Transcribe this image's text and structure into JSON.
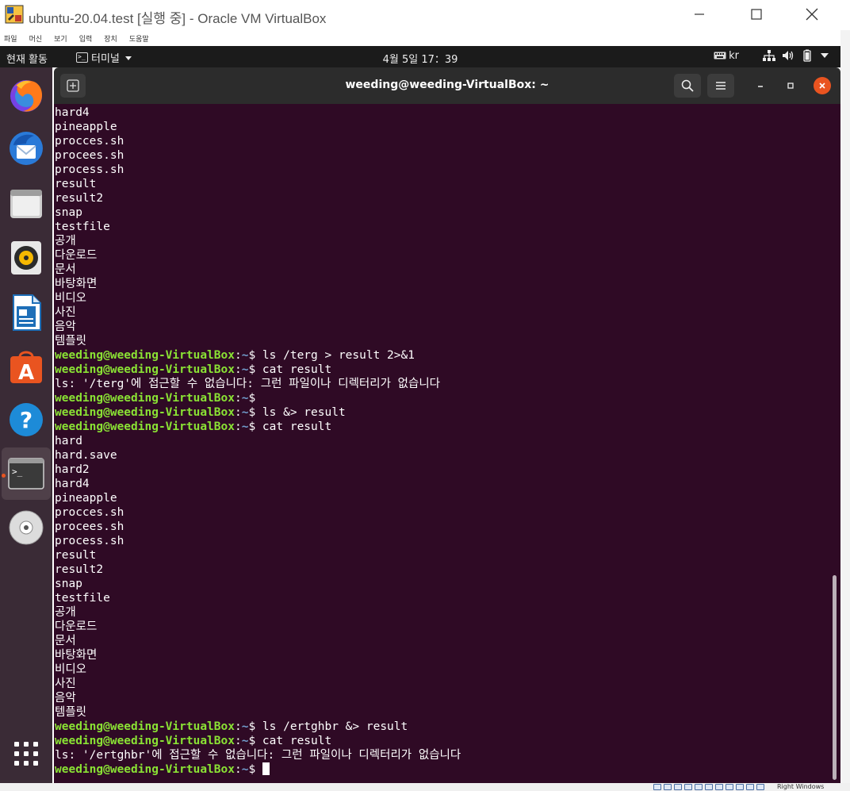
{
  "host_window": {
    "title": "ubuntu-20.04.test [실행 중] - Oracle VM VirtualBox",
    "menu": [
      "파일",
      "머신",
      "보기",
      "입력",
      "장치",
      "도움말"
    ],
    "host_key_label": "Right Windows"
  },
  "top_bar": {
    "activities": "현재 활동",
    "app_menu": "터미널",
    "clock": "4월 5일  17：39",
    "input_method": "kr"
  },
  "dock": {
    "items": [
      "firefox",
      "thunderbird",
      "files",
      "rhythmbox",
      "libreoffice-writer",
      "ubuntu-software",
      "help",
      "terminal",
      "dvd"
    ]
  },
  "terminal": {
    "title": "weeding@weeding-VirtualBox: ~",
    "prompt_user": "weeding@weeding-VirtualBox",
    "prompt_path": "~",
    "lines": [
      {
        "type": "out",
        "text": "hard4"
      },
      {
        "type": "out",
        "text": "pineapple"
      },
      {
        "type": "out",
        "text": "procces.sh"
      },
      {
        "type": "out",
        "text": "procees.sh"
      },
      {
        "type": "out",
        "text": "process.sh"
      },
      {
        "type": "out",
        "text": "result"
      },
      {
        "type": "out",
        "text": "result2"
      },
      {
        "type": "out",
        "text": "snap"
      },
      {
        "type": "out",
        "text": "testfile"
      },
      {
        "type": "out",
        "text": "공개"
      },
      {
        "type": "out",
        "text": "다운로드"
      },
      {
        "type": "out",
        "text": "문서"
      },
      {
        "type": "out",
        "text": "바탕화면"
      },
      {
        "type": "out",
        "text": "비디오"
      },
      {
        "type": "out",
        "text": "사진"
      },
      {
        "type": "out",
        "text": "음악"
      },
      {
        "type": "out",
        "text": "템플릿"
      },
      {
        "type": "cmd",
        "text": "ls /terg > result 2>&1"
      },
      {
        "type": "cmd",
        "text": "cat result"
      },
      {
        "type": "out",
        "text": "ls: '/terg'에 접근할 수 없습니다: 그런 파일이나 디렉터리가 없습니다"
      },
      {
        "type": "cmd",
        "text": ""
      },
      {
        "type": "cmd",
        "text": "ls &> result"
      },
      {
        "type": "cmd",
        "text": "cat result"
      },
      {
        "type": "out",
        "text": "hard"
      },
      {
        "type": "out",
        "text": "hard.save"
      },
      {
        "type": "out",
        "text": "hard2"
      },
      {
        "type": "out",
        "text": "hard4"
      },
      {
        "type": "out",
        "text": "pineapple"
      },
      {
        "type": "out",
        "text": "procces.sh"
      },
      {
        "type": "out",
        "text": "procees.sh"
      },
      {
        "type": "out",
        "text": "process.sh"
      },
      {
        "type": "out",
        "text": "result"
      },
      {
        "type": "out",
        "text": "result2"
      },
      {
        "type": "out",
        "text": "snap"
      },
      {
        "type": "out",
        "text": "testfile"
      },
      {
        "type": "out",
        "text": "공개"
      },
      {
        "type": "out",
        "text": "다운로드"
      },
      {
        "type": "out",
        "text": "문서"
      },
      {
        "type": "out",
        "text": "바탕화면"
      },
      {
        "type": "out",
        "text": "비디오"
      },
      {
        "type": "out",
        "text": "사진"
      },
      {
        "type": "out",
        "text": "음악"
      },
      {
        "type": "out",
        "text": "템플릿"
      },
      {
        "type": "cmd",
        "text": "ls /ertghbr &> result"
      },
      {
        "type": "cmd",
        "text": "cat result"
      },
      {
        "type": "out",
        "text": "ls: '/ertghbr'에 접근할 수 없습니다: 그런 파일이나 디렉터리가 없습니다"
      },
      {
        "type": "cursor",
        "text": ""
      }
    ]
  },
  "colors": {
    "terminal_bg": "#2f0a25",
    "prompt_user": "#8ae234",
    "prompt_path": "#729fcf",
    "dock_bg": "#3a2b36",
    "accent": "#e95420"
  }
}
